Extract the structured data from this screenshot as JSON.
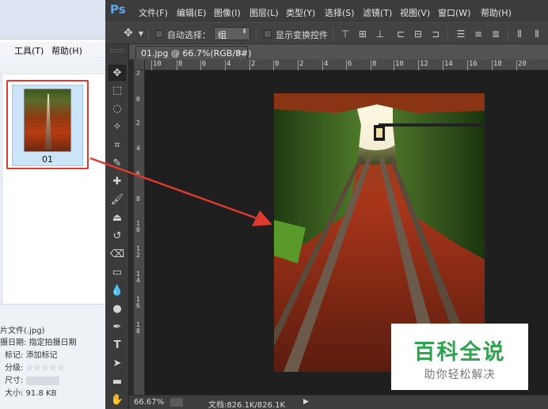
{
  "colors": {
    "annotation_red": "#e0392f",
    "watermark_green": "#2ea34e",
    "ps_blue": "#5ea8e8"
  },
  "explorer": {
    "menu": {
      "tools": "工具(T)",
      "help": "帮助(H)"
    },
    "thumbnail": {
      "name": "01",
      "icon": "jpg-thumbnail"
    },
    "details": {
      "file_type": "片文件(.jpg)",
      "date_key": "摄日期:",
      "date_value": "指定拍摄日期",
      "tags_key": "标记:",
      "tags_value": "添加标记",
      "rating_key": "分级:",
      "rating_value": "☆☆☆☆☆",
      "dims_key": "尺寸:",
      "size_key": "大小:",
      "size_value": "91.8 KB"
    }
  },
  "photoshop": {
    "logo": "Ps",
    "menu": [
      "文件(F)",
      "编辑(E)",
      "图像(I)",
      "图层(L)",
      "类型(Y)",
      "选择(S)",
      "滤镜(T)",
      "视图(V)",
      "窗口(W)",
      "帮助(H)"
    ],
    "options": {
      "auto_select_label": "自动选择：",
      "auto_select_value": "组",
      "show_transform_label": "显示变换控件"
    },
    "doc_tab": {
      "title": "01.jpg @ 66.7%(RGB/8#)",
      "close": "×"
    },
    "ruler_top": [
      "10",
      "8",
      "6",
      "4",
      "2",
      "0",
      "2",
      "4",
      "6",
      "8",
      "10",
      "12",
      "14",
      "16",
      "18",
      "20"
    ],
    "ruler_left": [
      "2",
      "0",
      "2",
      "4",
      "6",
      "8",
      "1\n0",
      "1\n2",
      "1\n4",
      "1\n6",
      "1\n8"
    ],
    "status": {
      "zoom": "66.67%",
      "doc_size": "文档:826.1K/826.1K",
      "arrow": "▶"
    }
  },
  "watermark": {
    "title": "百科全说",
    "subtitle": "助你轻松解决"
  }
}
